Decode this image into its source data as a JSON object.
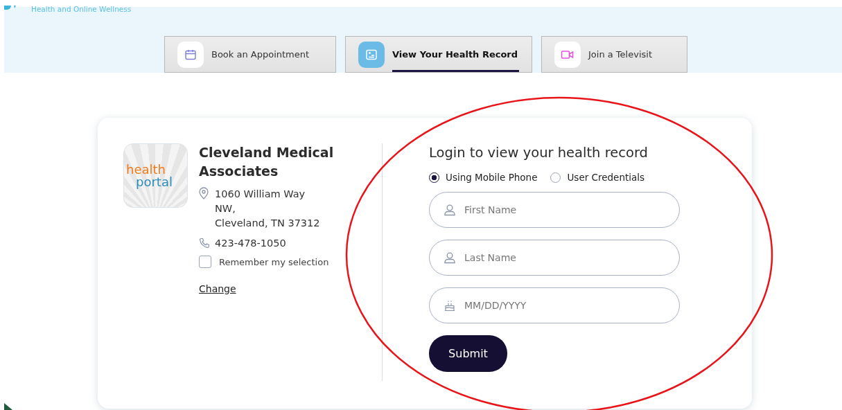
{
  "header": {
    "tagline": "Health and Online Wellness"
  },
  "tabs": [
    {
      "label": "Book an Appointment",
      "kind": "calendar",
      "selected": false
    },
    {
      "label": "View Your Health Record",
      "kind": "record",
      "selected": true
    },
    {
      "label": "Join a Televisit",
      "kind": "video",
      "selected": false
    }
  ],
  "practice": {
    "logo_top": "health",
    "logo_bottom": "portal",
    "name": "Cleveland Medical Associates",
    "address_lines": [
      "1060 William Way",
      "NW,",
      "Cleveland, TN 37312"
    ],
    "phone": "423-478-1050",
    "remember": {
      "label": "Remember my selection",
      "checked": false
    },
    "change_link": "Change"
  },
  "login": {
    "title": "Login to view your health record",
    "methods": [
      {
        "label": "Using Mobile Phone",
        "selected": true
      },
      {
        "label": "User Credentials",
        "selected": false
      }
    ],
    "fields": [
      {
        "placeholder": "First Name",
        "kind": "name"
      },
      {
        "placeholder": "Last Name",
        "kind": "name"
      },
      {
        "placeholder": "MM/DD/YYYY",
        "kind": "date"
      }
    ],
    "submit": "Submit"
  }
}
